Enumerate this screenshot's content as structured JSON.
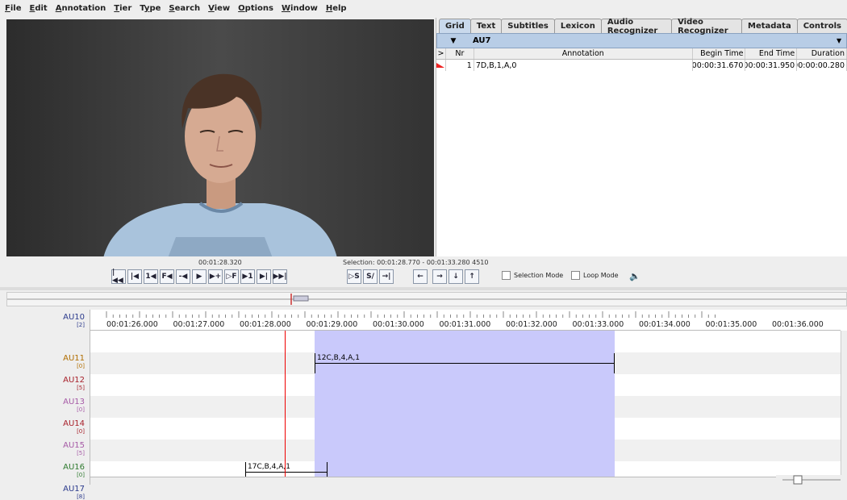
{
  "menu": [
    {
      "label": "File",
      "ul": "F",
      "rest": "ile"
    },
    {
      "label": "Edit",
      "ul": "E",
      "rest": "dit"
    },
    {
      "label": "Annotation",
      "ul": "A",
      "rest": "nnotation"
    },
    {
      "label": "Tier",
      "ul": "T",
      "rest": "ier"
    },
    {
      "label": "Type",
      "ul": "y",
      "pre": "T",
      "rest": "pe"
    },
    {
      "label": "Search",
      "ul": "S",
      "rest": "earch"
    },
    {
      "label": "View",
      "ul": "V",
      "rest": "iew"
    },
    {
      "label": "Options",
      "ul": "O",
      "rest": "ptions"
    },
    {
      "label": "Window",
      "ul": "W",
      "rest": "indow"
    },
    {
      "label": "Help",
      "ul": "H",
      "rest": "elp"
    }
  ],
  "tabs": [
    "Grid",
    "Text",
    "Subtitles",
    "Lexicon",
    "Audio Recognizer",
    "Video Recognizer",
    "Metadata",
    "Controls"
  ],
  "active_tab": "Grid",
  "grid": {
    "tier": "AU7",
    "headers": [
      ">",
      "Nr",
      "Annotation",
      "Begin Time",
      "End Time",
      "Duration"
    ],
    "rows": [
      {
        "nr": "1",
        "annotation": "7D,B,1,A,0",
        "begin": "00:00:31.670",
        "end": "00:00:31.950",
        "duration": "00:00:00.280"
      }
    ]
  },
  "player": {
    "current_time": "00:01:28.320",
    "selection": "Selection: 00:01:28.770 - 00:01:33.280  4510",
    "buttons": [
      "|◀◀",
      "|◀",
      "1◀",
      "F◀",
      "-◀",
      "▶",
      "▶+",
      "▷F",
      "▶1",
      "▶|",
      "▶▶|"
    ],
    "buttons2": [
      "▷S",
      "S/",
      "→|"
    ],
    "buttons3": [
      "←",
      "→",
      "↓",
      "↑"
    ],
    "selection_mode": "Selection Mode",
    "loop_mode": "Loop Mode",
    "speaker_icon": "speaker-icon"
  },
  "timeline": {
    "ticks": [
      "00:01:26.000",
      "00:01:27.000",
      "00:01:28.000",
      "00:01:29.000",
      "00:01:30.000",
      "00:01:31.000",
      "00:01:32.000",
      "00:01:33.000",
      "00:01:34.000",
      "00:01:35.000",
      "00:01:36.000"
    ],
    "tiers": [
      {
        "name": "AU10",
        "count": "[2]",
        "color": "#2b3a8c"
      },
      {
        "name": "AU11",
        "count": "[0]",
        "color": "#b06d00"
      },
      {
        "name": "AU12",
        "count": "[5]",
        "color": "#a8202a"
      },
      {
        "name": "AU13",
        "count": "[0]",
        "color": "#a65aa6"
      },
      {
        "name": "AU14",
        "count": "[0]",
        "color": "#a8202a"
      },
      {
        "name": "AU15",
        "count": "[5]",
        "color": "#a65aa6"
      },
      {
        "name": "AU16",
        "count": "[0]",
        "color": "#2f7a2f"
      },
      {
        "name": "AU17",
        "count": "[8]",
        "color": "#2b3a8c"
      }
    ],
    "annotations": [
      {
        "tier": "AU12",
        "text": "12C,B,4,A,1"
      },
      {
        "tier": "AU17",
        "text": "17C,B,4,A,1"
      }
    ]
  }
}
